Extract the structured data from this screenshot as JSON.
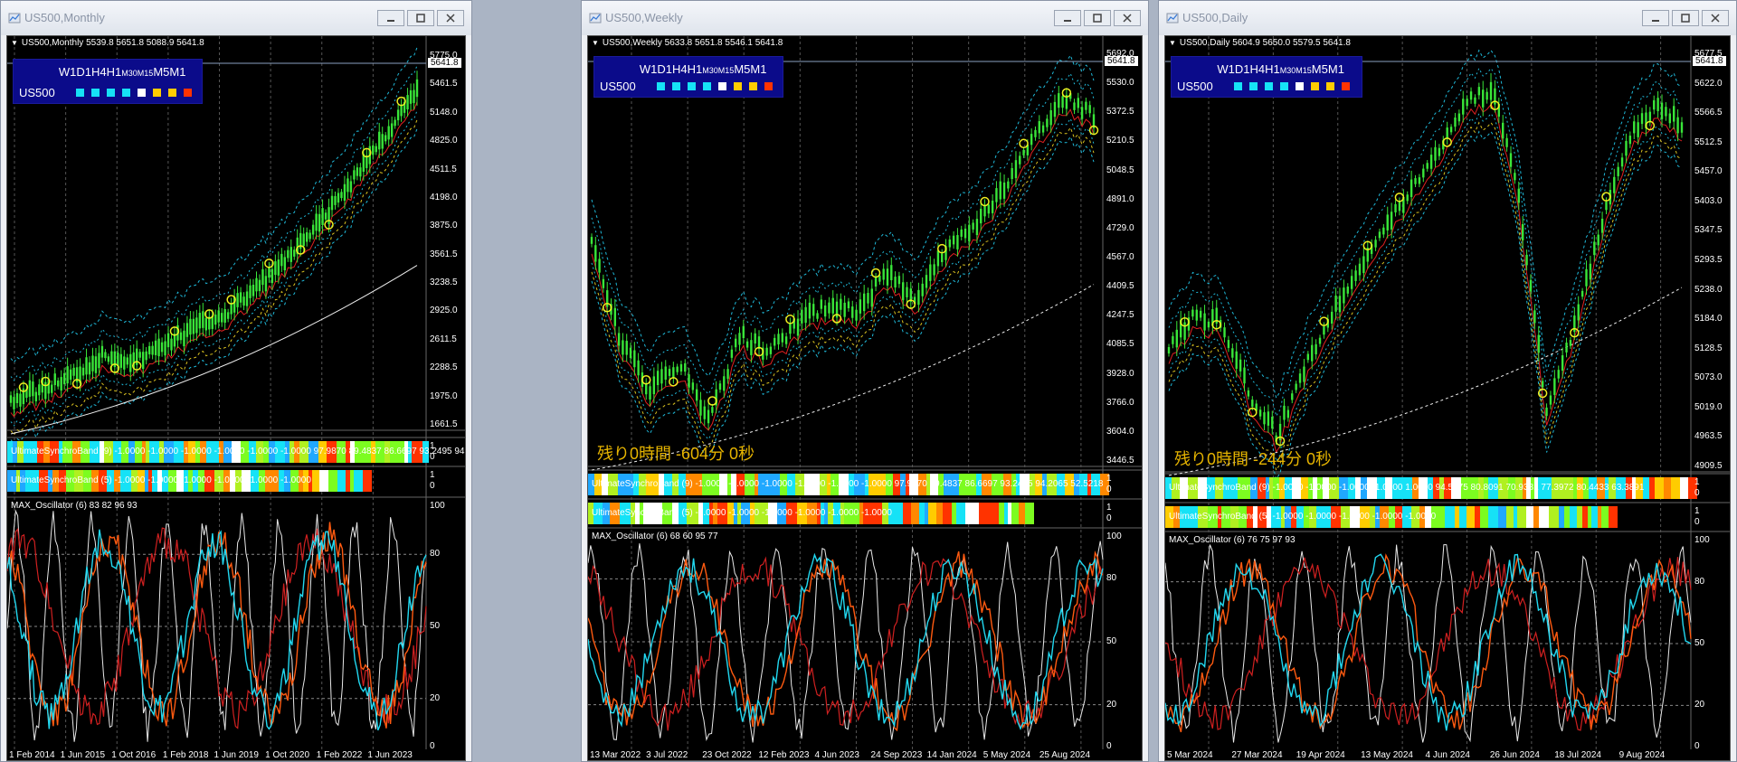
{
  "windows": [
    {
      "key": "monthly",
      "title": "US500,Monthly",
      "header": "US500,Monthly  5539.8 5651.8 5088.9 5641.8",
      "tf_labels": [
        "W1",
        "D1",
        "H4",
        "H1",
        "M30",
        "M15",
        "M5",
        "M1"
      ],
      "symbol": "US500",
      "timer": "",
      "current_price": "5641.8",
      "price_labels": [
        "5775.0",
        "5461.5",
        "5148.0",
        "4825.0",
        "4511.5",
        "4198.0",
        "3875.0",
        "3561.5",
        "3238.5",
        "2925.0",
        "2611.5",
        "2288.5",
        "1975.0",
        "1661.5"
      ],
      "indicator1": "UltimateSynchroBand (9) -1.0000 -1.0000 -1.0000 -1.0000 -1.0000 -1.0000 97.9870 89.4837 86.6697 93.2495 94.2065 52.5218",
      "indicator2": "UltimateSynchroBand (5) -1.0000 -1.0000 -1.0000 -1.0000 -1.0000 -1.0000",
      "osc_label": "MAX_Oscillator (6) 83 82 96 93",
      "osc_levels": [
        "100",
        "80",
        "50",
        "20",
        "0"
      ],
      "dates": [
        "1 Feb 2014",
        "1 Jun 2015",
        "1 Oct 2016",
        "1 Feb 2018",
        "1 Jun 2019",
        "1 Oct 2020",
        "1 Feb 2022",
        "1 Jun 2023"
      ]
    },
    {
      "key": "weekly",
      "title": "US500,Weekly",
      "header": "US500,Weekly  5633.8 5651.8 5546.1 5641.8",
      "tf_labels": [
        "W1",
        "D1",
        "H4",
        "H1",
        "M30",
        "M15",
        "M5",
        "M1"
      ],
      "symbol": "US500",
      "timer": "残り0時間 -604分 0秒",
      "current_price": "5641.8",
      "price_labels": [
        "5692.0",
        "5530.0",
        "5372.5",
        "5210.5",
        "5048.5",
        "4891.0",
        "4729.0",
        "4567.0",
        "4409.5",
        "4247.5",
        "4085.5",
        "3928.0",
        "3766.0",
        "3604.0",
        "3446.5"
      ],
      "indicator1": "UltimateSynchroBand (9) -1.0000 -1.0000 -1.0000 -1.0000 -1.0000 -1.0000 97.9870 89.4837 86.6697 93.2495 94.2065 52.5218",
      "indicator2": "UltimateSynchroBand (5) -1.0000 -1.0000 -1.0000 -1.0000 -1.0000 -1.0000",
      "osc_label": "MAX_Oscillator (6) 68 60 95 77",
      "osc_levels": [
        "100",
        "80",
        "50",
        "20",
        "0"
      ],
      "dates": [
        "13 Mar 2022",
        "3 Jul 2022",
        "23 Oct 2022",
        "12 Feb 2023",
        "4 Jun 2023",
        "24 Sep 2023",
        "14 Jan 2024",
        "5 May 2024",
        "25 Aug 2024"
      ]
    },
    {
      "key": "daily",
      "title": "US500,Daily",
      "header": "US500,Daily  5604.9 5650.0 5579.5 5641.8",
      "tf_labels": [
        "W1",
        "D1",
        "H4",
        "H1",
        "M30",
        "M15",
        "M5",
        "M1"
      ],
      "symbol": "US500",
      "timer": "残り0時間 -244分 0秒",
      "current_price": "5641.8",
      "price_labels": [
        "5677.5",
        "5622.0",
        "5566.5",
        "5512.5",
        "5457.0",
        "5403.0",
        "5347.5",
        "5293.5",
        "5238.0",
        "5184.0",
        "5128.5",
        "5073.0",
        "5019.0",
        "4963.5",
        "4909.5"
      ],
      "indicator1": "UltimateSynchroBand (9) -1.0000 -1.0000 -1.0000 -1.0000 1.0000 94.5775 80.8091 70.9381 77.3972 80.4433 63.3891",
      "indicator2": "UltimateSynchroBand (5) -1.0000 -1.0000 -1.0000 -1.0000 -1.0000",
      "osc_label": "MAX_Oscillator (6) 76 75 97 93",
      "osc_levels": [
        "100",
        "80",
        "50",
        "20",
        "0"
      ],
      "dates": [
        "5 Mar 2024",
        "27 Mar 2024",
        "19 Apr 2024",
        "13 May 2024",
        "4 Jun 2024",
        "26 Jun 2024",
        "18 Jul 2024",
        "9 Aug 2024"
      ]
    }
  ],
  "colors": {
    "background": "#000000",
    "candle": "#39e639",
    "ma_red": "#e02020",
    "band_cyan": "#1fb8d8",
    "band_yellow": "#d8c020",
    "osc_cyan": "#22d8f0",
    "osc_orange": "#ff5a10",
    "osc_red": "#d02020",
    "osc_white": "#e8e8e8",
    "marker": "#f0f020",
    "panel_blue": "#0b0b8a",
    "timer": "#e6b400"
  },
  "tf_square_colors": [
    "#16e2f6",
    "#16e2f6",
    "#16e2f6",
    "#16e2f6",
    "#ffffff",
    "#ffcc00",
    "#ffcc00",
    "#ff3300"
  ]
}
